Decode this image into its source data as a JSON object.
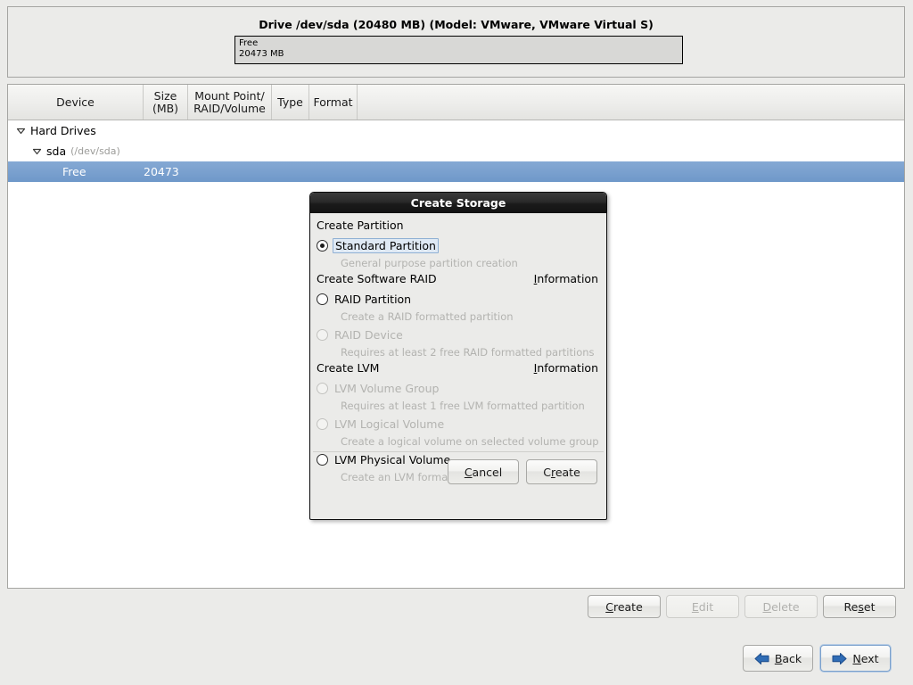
{
  "drive_panel": {
    "title": "Drive /dev/sda (20480 MB) (Model: VMware, VMware Virtual S)",
    "segment": {
      "name": "Free",
      "size": "20473 MB"
    }
  },
  "device_tree": {
    "columns": [
      {
        "label": "Device"
      },
      {
        "label": "Size\n(MB)",
        "line1": "Size",
        "line2": "(MB)"
      },
      {
        "label": "Mount Point/\nRAID/Volume",
        "line1": "Mount Point/",
        "line2": "RAID/Volume"
      },
      {
        "label": "Type"
      },
      {
        "label": "Format"
      },
      {
        "label": ""
      }
    ],
    "rows": [
      {
        "device": "Hard Drives",
        "path": "",
        "size": "",
        "mount": "",
        "type": "",
        "format": "",
        "indent": 0,
        "expander": "expander-down-icon",
        "selected": false
      },
      {
        "device": "sda",
        "path": "(/dev/sda)",
        "size": "",
        "mount": "",
        "type": "",
        "format": "",
        "indent": 1,
        "expander": "expander-down-icon",
        "selected": false
      },
      {
        "device": "Free",
        "path": "",
        "size": "20473",
        "mount": "",
        "type": "",
        "format": "",
        "indent": 2,
        "expander": "",
        "selected": true
      }
    ]
  },
  "actions": {
    "create": {
      "label": "Create",
      "mnemonic": "C",
      "enabled": true
    },
    "edit": {
      "label": "Edit",
      "mnemonic": "E",
      "enabled": false
    },
    "delete": {
      "label": "Delete",
      "mnemonic": "D",
      "enabled": false
    },
    "reset": {
      "label": "Reset",
      "mnemonic": "s",
      "enabled": true
    }
  },
  "navigation": {
    "back": {
      "label": "Back",
      "mnemonic": "B",
      "icon": "arrow-left-icon"
    },
    "next": {
      "label": "Next",
      "mnemonic": "N",
      "icon": "arrow-right-icon",
      "focused": true
    }
  },
  "dialog": {
    "title": "Create Storage",
    "groups": [
      {
        "heading": "Create Partition",
        "info": null,
        "options": [
          {
            "label": "Standard Partition",
            "description": "General purpose partition creation",
            "selected": true,
            "enabled": true,
            "focused": true
          }
        ]
      },
      {
        "heading": "Create Software RAID",
        "info": "Information",
        "info_mnemonic": "I",
        "options": [
          {
            "label": "RAID Partition",
            "description": "Create a RAID formatted partition",
            "selected": false,
            "enabled": true,
            "focused": false
          },
          {
            "label": "RAID Device",
            "description": "Requires at least 2 free RAID formatted partitions",
            "selected": false,
            "enabled": false,
            "focused": false
          }
        ]
      },
      {
        "heading": "Create LVM",
        "info": "Information",
        "info_mnemonic": "I",
        "options": [
          {
            "label": "LVM Volume Group",
            "description": "Requires at least 1 free LVM formatted partition",
            "selected": false,
            "enabled": false,
            "focused": false
          },
          {
            "label": "LVM Logical Volume",
            "description": "Create a logical volume on selected volume group",
            "selected": false,
            "enabled": false,
            "focused": false
          },
          {
            "label": "LVM Physical Volume",
            "description": "Create an LVM formatted partition",
            "selected": false,
            "enabled": true,
            "focused": false
          }
        ]
      }
    ],
    "buttons": {
      "cancel": {
        "label": "Cancel",
        "mnemonic": "C"
      },
      "create": {
        "label": "Create",
        "mnemonic": "r"
      }
    }
  },
  "colors": {
    "window_bg": "#ebebe9",
    "selection_blue": "#7da1cc",
    "accent_arrow_blue": "#2f6cb5",
    "disabled_text": "#b3b3b0",
    "dialog_titlebar": "#1b1b1b"
  }
}
